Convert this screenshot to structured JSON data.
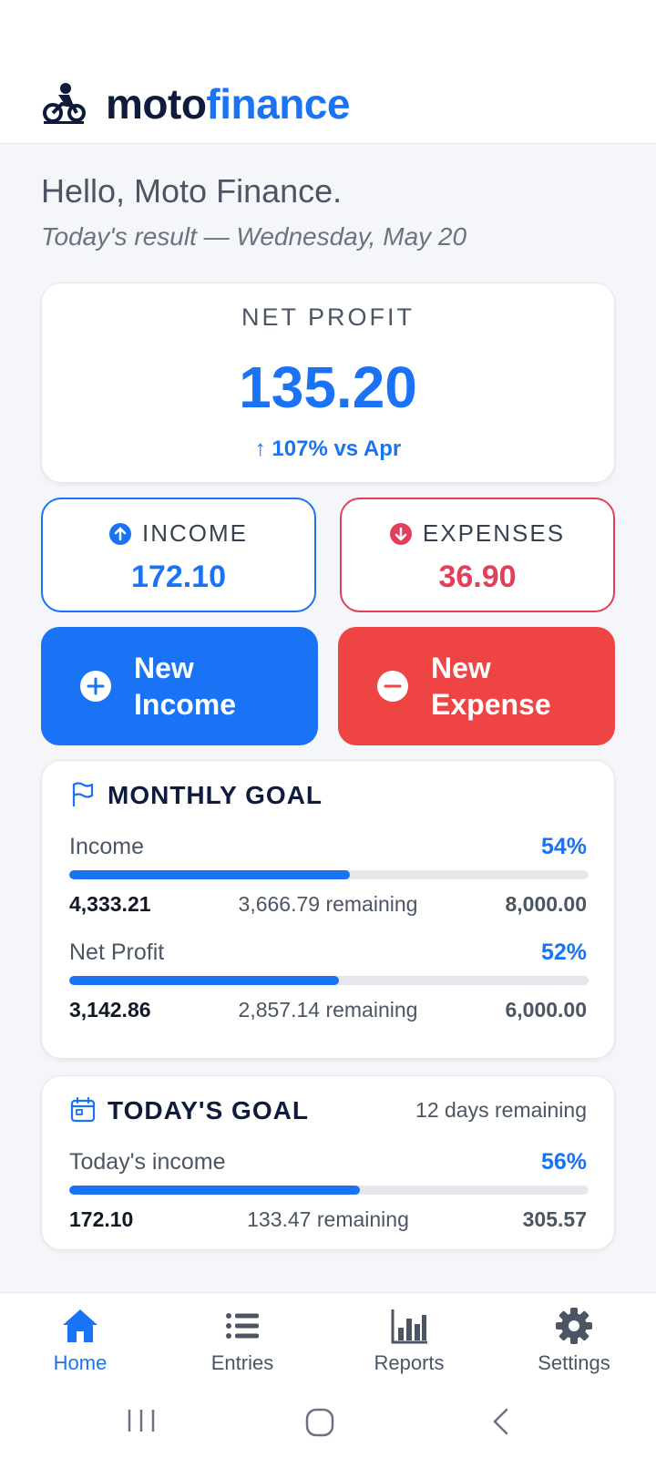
{
  "app": {
    "brand_part1": "moto",
    "brand_part2": "finance",
    "logo_icon": "motorcycle-rider-icon"
  },
  "greeting": {
    "hello": "Hello, Moto Finance.",
    "subtitle": "Today's result — Wednesday, May 20"
  },
  "net_profit": {
    "label": "NET PROFIT",
    "value": "135.20",
    "change": "↑ 107% vs Apr"
  },
  "stats": {
    "income_label": "INCOME",
    "income_value": "172.10",
    "expenses_label": "EXPENSES",
    "expenses_value": "36.90"
  },
  "actions": {
    "new_income": "New Income",
    "new_expense": "New Expense"
  },
  "monthly_goal": {
    "title": "MONTHLY GOAL",
    "rows": [
      {
        "label": "Income",
        "percent": "54%",
        "progress": 0.54,
        "current": "4,333.21",
        "remaining": "3,666.79 remaining",
        "target": "8,000.00"
      },
      {
        "label": "Net Profit",
        "percent": "52%",
        "progress": 0.52,
        "current": "3,142.86",
        "remaining": "2,857.14 remaining",
        "target": "6,000.00"
      }
    ]
  },
  "today_goal": {
    "title": "TODAY'S GOAL",
    "days_remaining": "12 days remaining",
    "row": {
      "label": "Today's income",
      "percent": "56%",
      "progress": 0.56,
      "current": "172.10",
      "remaining": "133.47 remaining",
      "target": "305.57"
    }
  },
  "nav": {
    "items": [
      {
        "label": "Home",
        "icon": "home-icon",
        "active": true
      },
      {
        "label": "Entries",
        "icon": "list-icon",
        "active": false
      },
      {
        "label": "Reports",
        "icon": "bar-chart-icon",
        "active": false
      },
      {
        "label": "Settings",
        "icon": "gear-icon",
        "active": false
      }
    ]
  },
  "colors": {
    "primary": "#1a73f5",
    "danger": "#ef4444",
    "expense_text": "#e33f5a",
    "brand_dark": "#0f1b3d"
  }
}
